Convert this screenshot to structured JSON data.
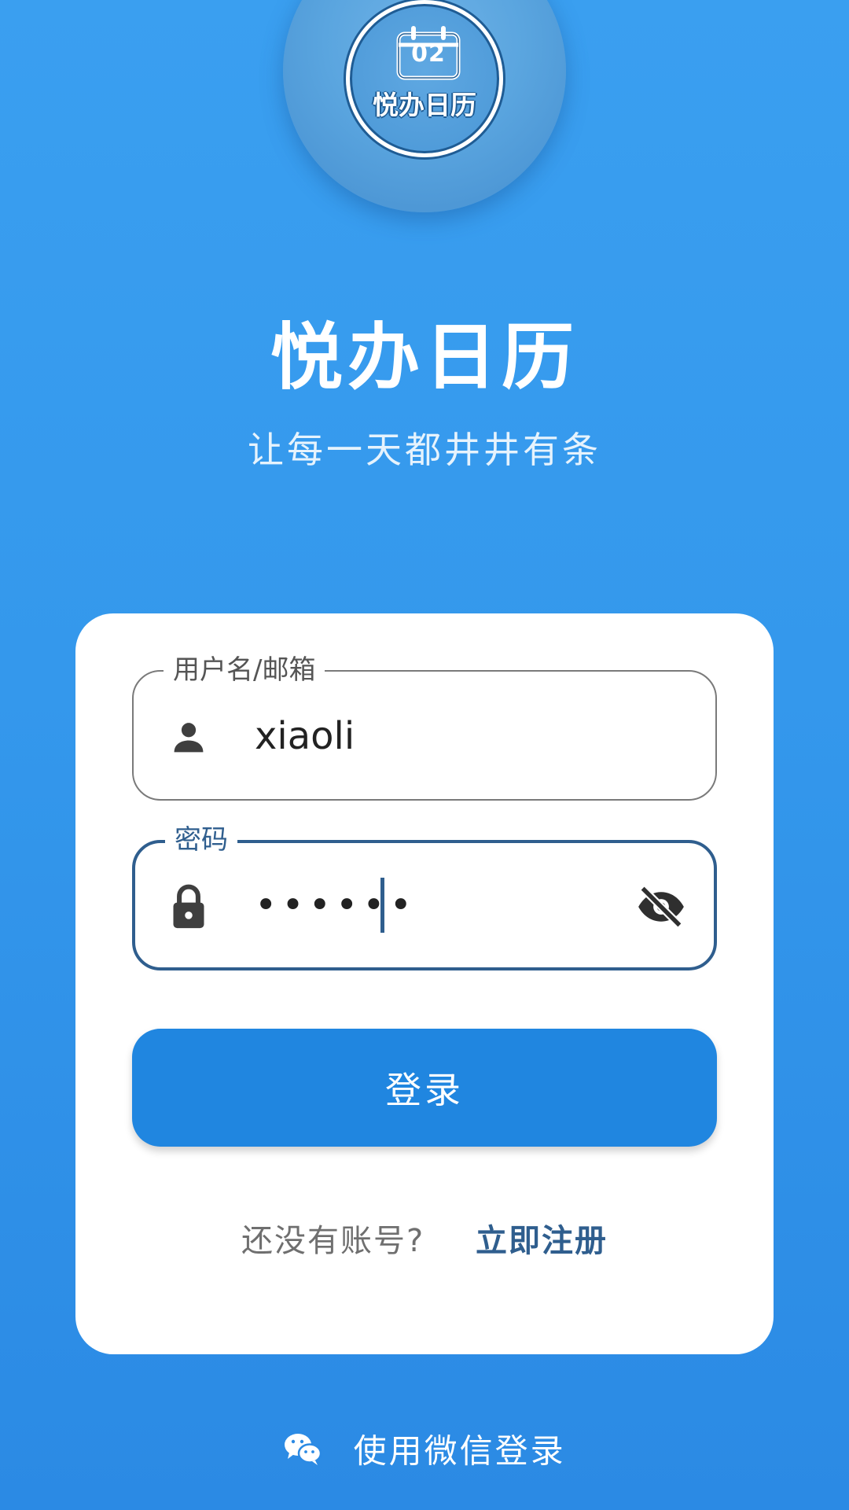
{
  "logo": {
    "date_number": "02",
    "text": "悦办日历",
    "icon": "calendar-icon"
  },
  "header": {
    "title": "悦办日历",
    "subtitle": "让每一天都井井有条"
  },
  "form": {
    "username": {
      "label": "用户名/邮箱",
      "value": "xiaoli",
      "icon": "person-icon"
    },
    "password": {
      "label": "密码",
      "masked_value": "••••••",
      "icon": "lock-icon",
      "toggle_icon": "eye-off-icon"
    },
    "login_button": "登录",
    "signup_prompt": "还没有账号?",
    "signup_link": "立即注册"
  },
  "wechat": {
    "label": "使用微信登录",
    "icon": "wechat-icon"
  },
  "colors": {
    "background": "#3498ec",
    "primary_button": "#2086e0",
    "focus_border": "#2f5e8e",
    "card": "#ffffff"
  }
}
